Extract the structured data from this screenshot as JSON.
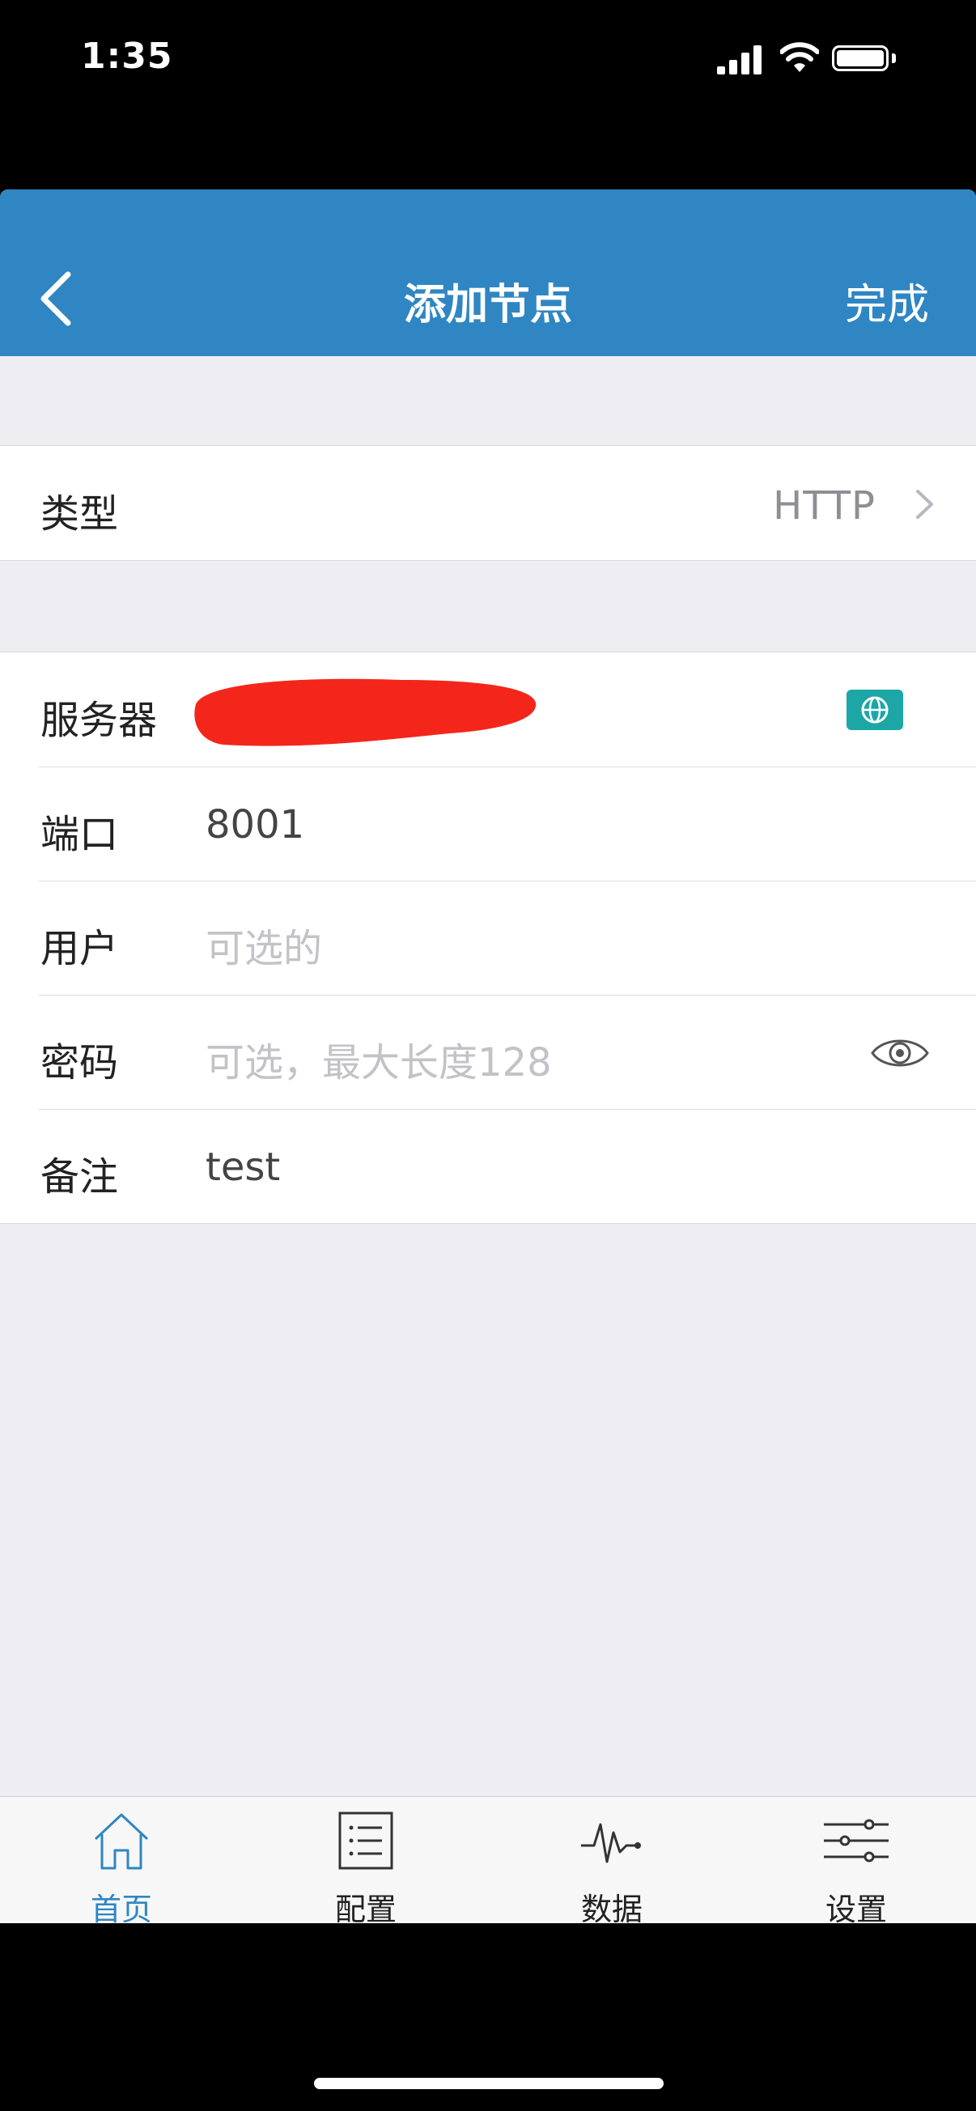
{
  "status_bar": {
    "time": "1:35"
  },
  "navbar": {
    "title": "添加节点",
    "done_label": "完成"
  },
  "type_row": {
    "label": "类型",
    "value": "HTTP"
  },
  "form": {
    "server": {
      "label": "服务器"
    },
    "port": {
      "label": "端口",
      "value": "8001"
    },
    "user": {
      "label": "用户",
      "placeholder": "可选的"
    },
    "password": {
      "label": "密码",
      "placeholder": "可选，最大长度128"
    },
    "note": {
      "label": "备注",
      "value": "test"
    }
  },
  "tabbar": {
    "items": [
      {
        "label": "首页",
        "icon": "home-icon",
        "active": true
      },
      {
        "label": "配置",
        "icon": "list-icon",
        "active": false
      },
      {
        "label": "数据",
        "icon": "pulse-icon",
        "active": false
      },
      {
        "label": "设置",
        "icon": "sliders-icon",
        "active": false
      }
    ]
  },
  "colors": {
    "accent": "#2f86c2",
    "globe_button": "#1ca7a6",
    "redaction": "#f4261b",
    "background": "#ededf2"
  }
}
